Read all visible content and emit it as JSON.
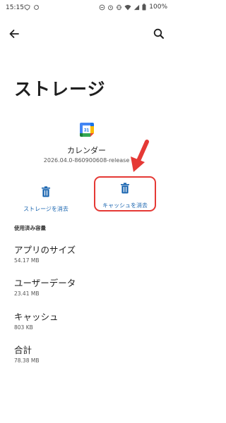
{
  "status_bar": {
    "time": "15:15",
    "battery": "100%"
  },
  "page": {
    "title": "ストレージ"
  },
  "app": {
    "icon_label": "31",
    "name": "カレンダー",
    "version": "2026.04.0-860900608-release"
  },
  "actions": {
    "clear_storage": "ストレージを消去",
    "clear_cache": "キャッシュを消去"
  },
  "usage": {
    "header": "使用済み容量",
    "items": [
      {
        "label": "アプリのサイズ",
        "value": "54.17 MB"
      },
      {
        "label": "ユーザーデータ",
        "value": "23.41 MB"
      },
      {
        "label": "キャッシュ",
        "value": "803 KB"
      },
      {
        "label": "合計",
        "value": "78.38 MB"
      }
    ]
  },
  "colors": {
    "accent": "#1b66b0",
    "highlight": "#e53935"
  },
  "icons": {
    "back": "arrow-back-icon",
    "search": "search-icon",
    "trash": "trash-icon"
  }
}
